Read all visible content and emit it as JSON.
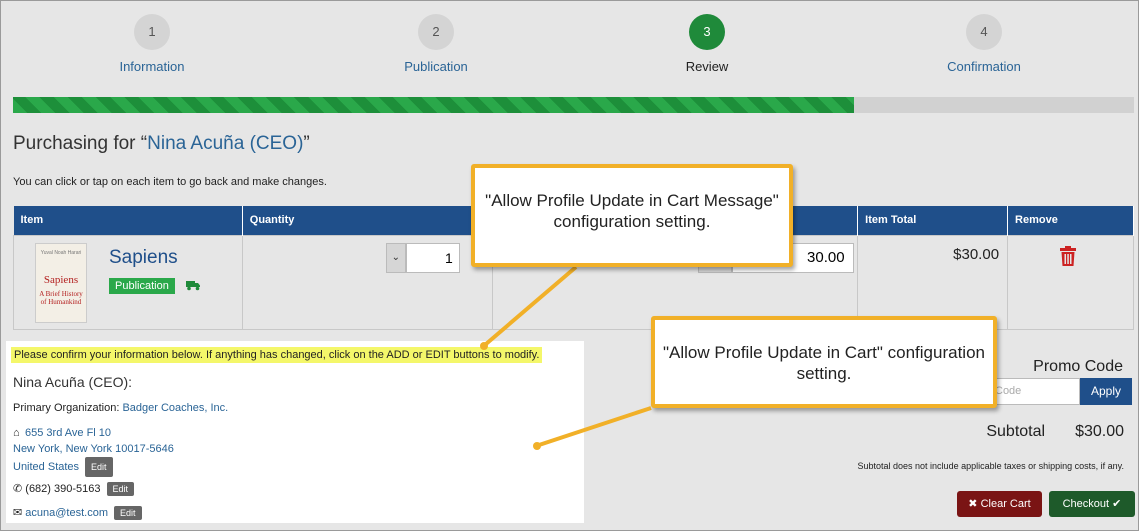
{
  "steps": [
    {
      "number": "1",
      "label": "Information"
    },
    {
      "number": "2",
      "label": "Publication"
    },
    {
      "number": "3",
      "label": "Review"
    },
    {
      "number": "4",
      "label": "Confirmation"
    }
  ],
  "progress": {
    "fraction": 0.75
  },
  "purchasing": {
    "prefix": "Purchasing for “",
    "name": "Nina Acuña (CEO)",
    "suffix": "”"
  },
  "hint": "You can click or tap on each item to go back and make changes.",
  "table": {
    "headers": [
      "Item",
      "Quantity",
      "",
      "Item Total",
      "Remove"
    ],
    "row": {
      "book_cover": {
        "author": "Yuval Noah Harari",
        "title": "Sapiens",
        "subtitle": "A Brief History of Humankind"
      },
      "title": "Sapiens",
      "badge": "Publication",
      "quantity": "1",
      "price": "30.00",
      "item_total": "$30.00"
    }
  },
  "profile": {
    "confirm_message": "Please confirm your information below. If anything has changed, click on the ADD or EDIT buttons to modify.",
    "name": "Nina Acuña (CEO):",
    "org_label": "Primary Organization: ",
    "org_value": "Badger Coaches, Inc.",
    "address_line1": "655 3rd Ave Fl 10",
    "address_line2": "New York, New York 10017-5646",
    "country": "United States",
    "phone": "(682) 390-5163",
    "email": "acuna@test.com",
    "edit_label": "Edit"
  },
  "promo": {
    "label": "Promo Code",
    "placeholder": "Code",
    "apply": "Apply"
  },
  "subtotal": {
    "label": "Subtotal",
    "value": "$30.00",
    "disclaimer": "Subtotal does not include applicable taxes or shipping costs, if any."
  },
  "buttons": {
    "clear": "Clear Cart",
    "checkout": "Checkout"
  },
  "callouts": {
    "cart_message": "\"Allow Profile Update in Cart Message\" configuration setting.",
    "cart": "\"Allow Profile Update in Cart\" configuration setting."
  },
  "colors": {
    "accent": "#1f4f8a",
    "success": "#2aa84a",
    "danger": "#cc2222",
    "callout_border": "#f1b028"
  }
}
